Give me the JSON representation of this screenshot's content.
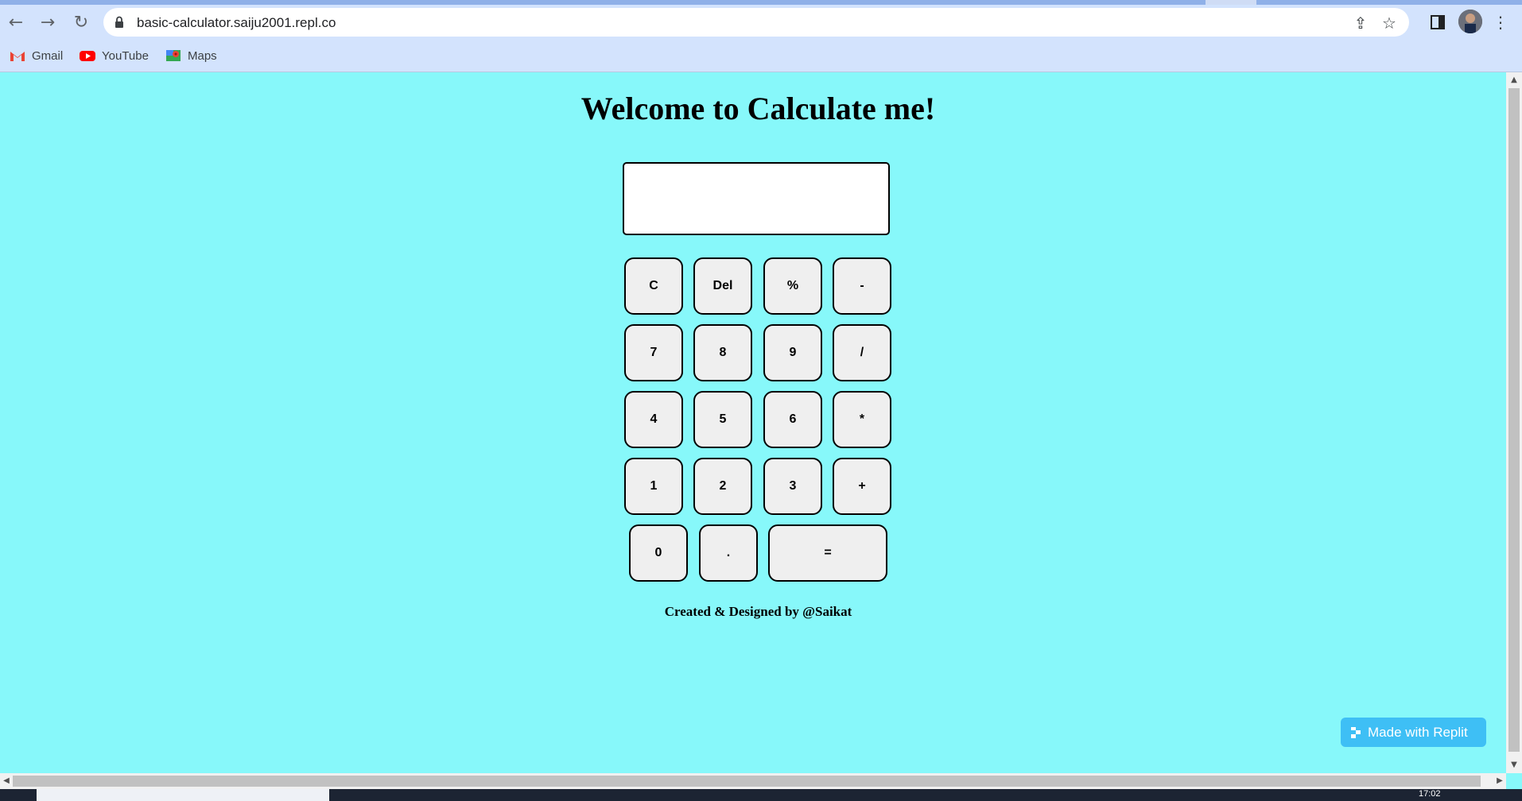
{
  "browser": {
    "url": "basic-calculator.saiju2001.repl.co",
    "bookmarks": [
      {
        "label": "Gmail",
        "icon": "gmail-icon"
      },
      {
        "label": "YouTube",
        "icon": "youtube-icon"
      },
      {
        "label": "Maps",
        "icon": "maps-icon"
      }
    ]
  },
  "page": {
    "title": "Welcome to Calculate me!",
    "display_value": "",
    "keys": {
      "row1": [
        "C",
        "Del",
        "%",
        "-"
      ],
      "row2": [
        "7",
        "8",
        "9",
        "/"
      ],
      "row3": [
        "4",
        "5",
        "6",
        "*"
      ],
      "row4": [
        "1",
        "2",
        "3",
        "+"
      ],
      "row5": [
        "0",
        ".",
        "="
      ]
    },
    "credit": "Created & Designed by @Saikat",
    "replit_badge": "Made with Replit"
  },
  "taskbar": {
    "clock": "17:02"
  }
}
